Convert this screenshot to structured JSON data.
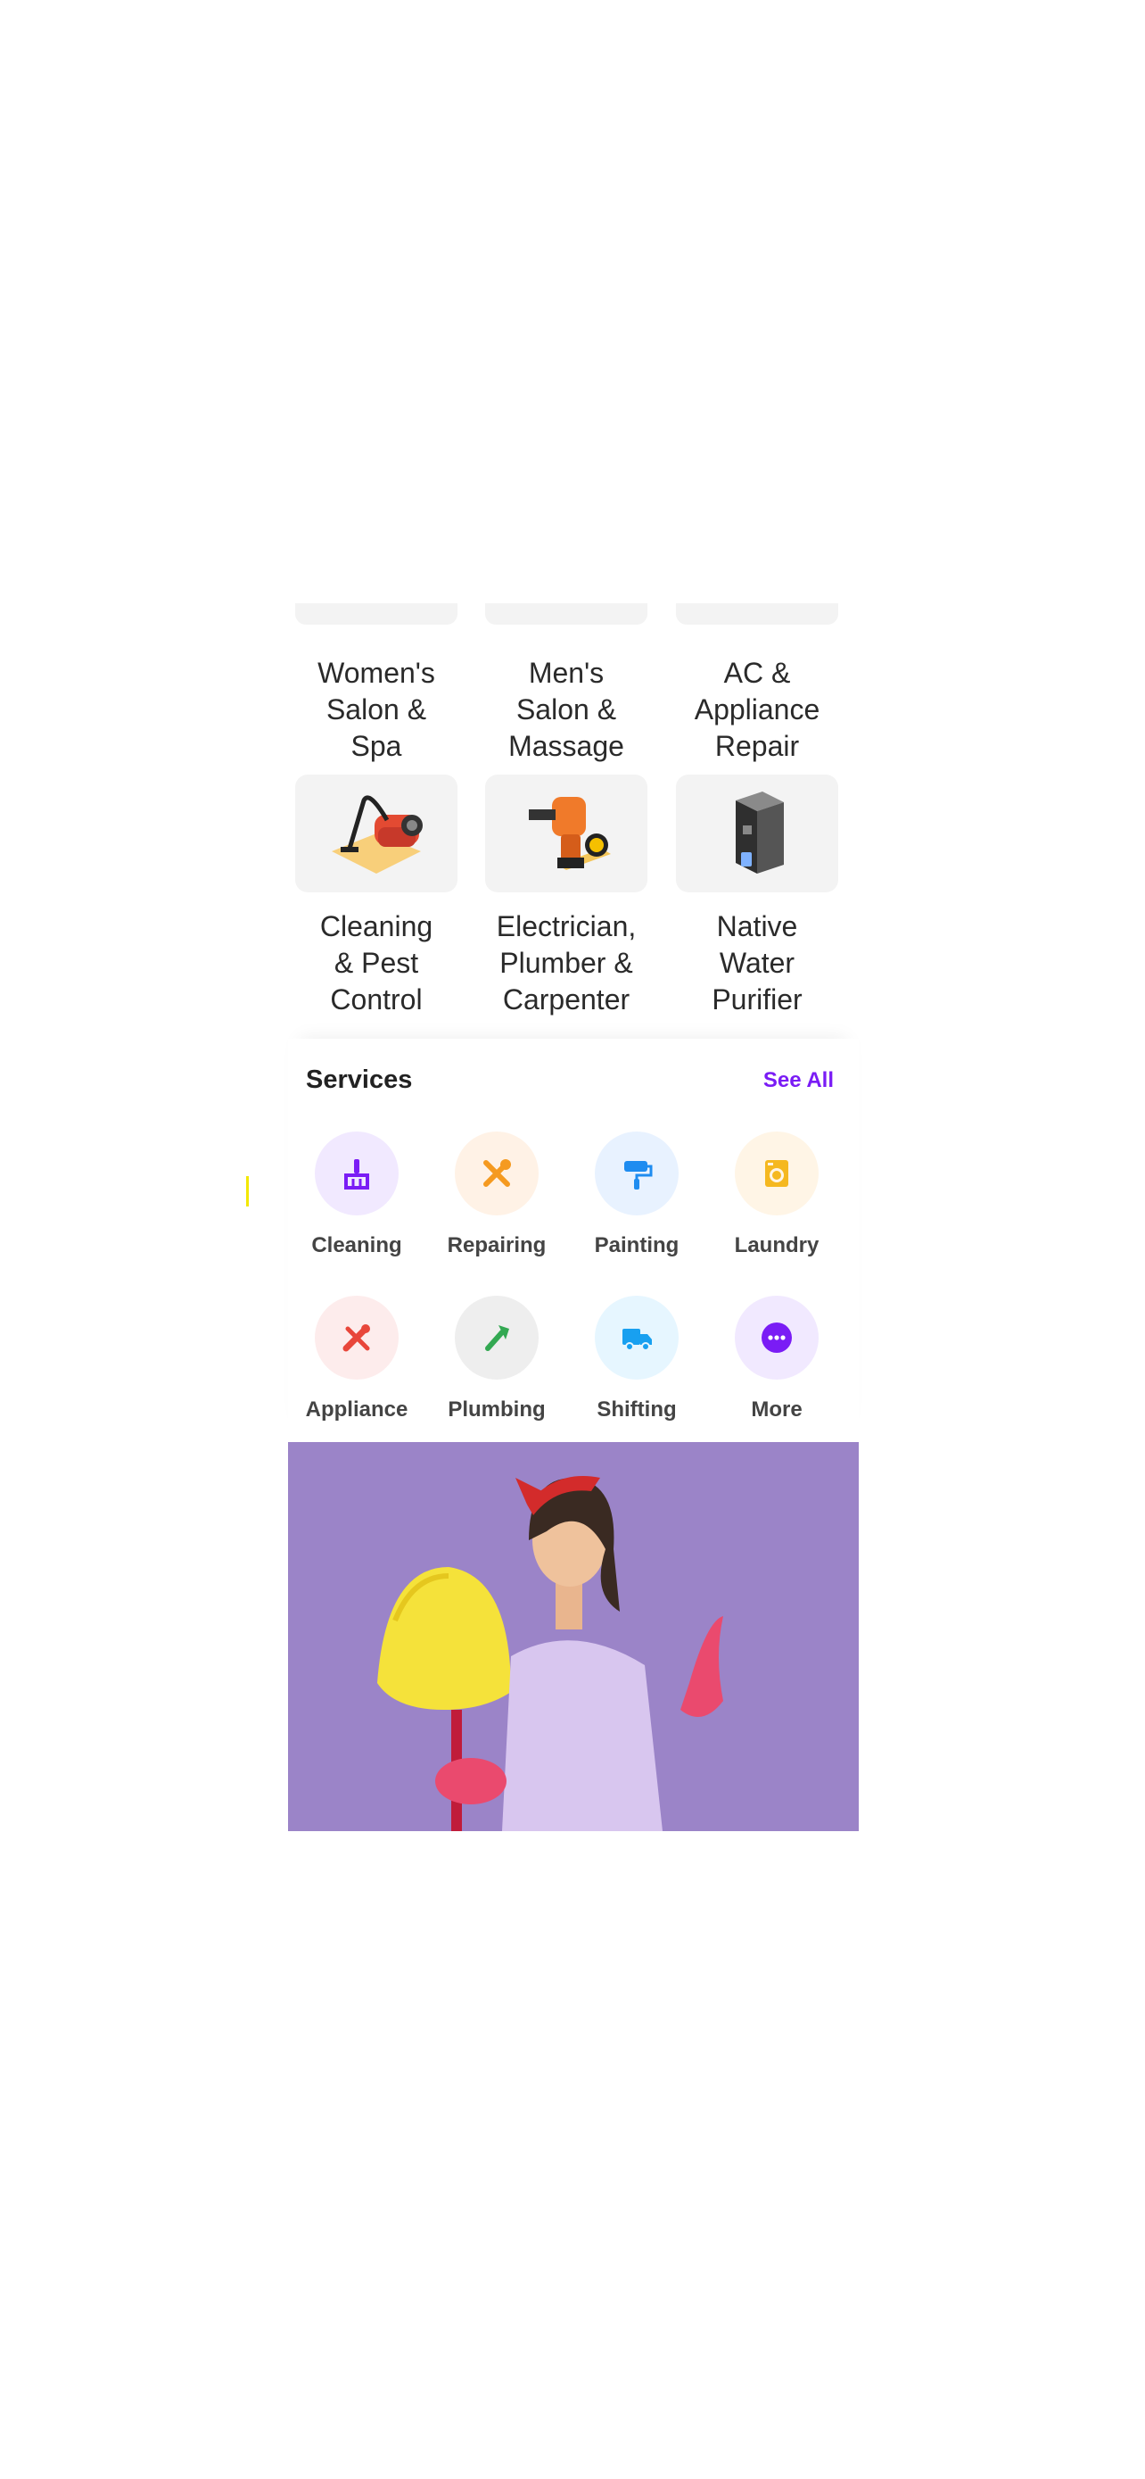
{
  "categories": [
    {
      "label": "Women's\nSalon &\nSpa"
    },
    {
      "label": "Men's\nSalon &\nMassage"
    },
    {
      "label": "AC &\nAppliance\nRepair"
    },
    {
      "label": "Cleaning\n& Pest\nControl",
      "icon": "vacuum-cleaner-icon"
    },
    {
      "label": "Electrician,\nPlumber &\nCarpenter",
      "icon": "drill-icon"
    },
    {
      "label": "Native\nWater\nPurifier",
      "icon": "water-purifier-icon"
    }
  ],
  "services": {
    "title": "Services",
    "see_all": "See All",
    "items": [
      {
        "label": "Cleaning",
        "icon": "broom-icon",
        "color": "#7a1cf5",
        "bg": "#f1e9ff"
      },
      {
        "label": "Repairing",
        "icon": "tools-icon",
        "color": "#f59a20",
        "bg": "#fff2e6"
      },
      {
        "label": "Painting",
        "icon": "paint-roller-icon",
        "color": "#1e8cf0",
        "bg": "#e8f2ff"
      },
      {
        "label": "Laundry",
        "icon": "washing-machine-icon",
        "color": "#f5b820",
        "bg": "#fff5e6"
      },
      {
        "label": "Appliance",
        "icon": "appliance-icon",
        "color": "#e8463a",
        "bg": "#fdecec"
      },
      {
        "label": "Plumbing",
        "icon": "wrench-icon",
        "color": "#33a852",
        "bg": "#eeeeee"
      },
      {
        "label": "Shifting",
        "icon": "truck-icon",
        "color": "#18a0f0",
        "bg": "#e6f6ff"
      },
      {
        "label": "More",
        "icon": "more-icon",
        "color": "#7a1cf5",
        "bg": "#f1e9ff"
      }
    ]
  },
  "banner": {
    "bg": "#9b84c8"
  }
}
